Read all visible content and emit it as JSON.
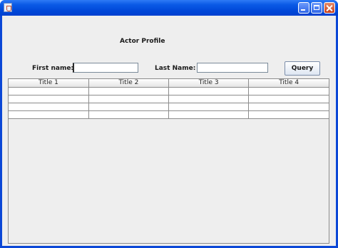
{
  "window": {
    "title": "",
    "app_icon": "java-cup-icon",
    "controls": {
      "minimize": "minimize-icon",
      "maximize": "maximize-icon",
      "close": "close-icon"
    }
  },
  "form": {
    "heading": "Actor Profile",
    "first_name_label": "First name:",
    "first_name_value": "",
    "last_name_label": "Last Name:",
    "last_name_value": "",
    "query_label": "Query"
  },
  "table": {
    "columns": [
      "Title 1",
      "Title 2",
      "Title 3",
      "Title 4"
    ],
    "rows": [
      [
        "",
        "",
        "",
        ""
      ],
      [
        "",
        "",
        "",
        ""
      ],
      [
        "",
        "",
        "",
        ""
      ],
      [
        "",
        "",
        "",
        ""
      ]
    ]
  }
}
